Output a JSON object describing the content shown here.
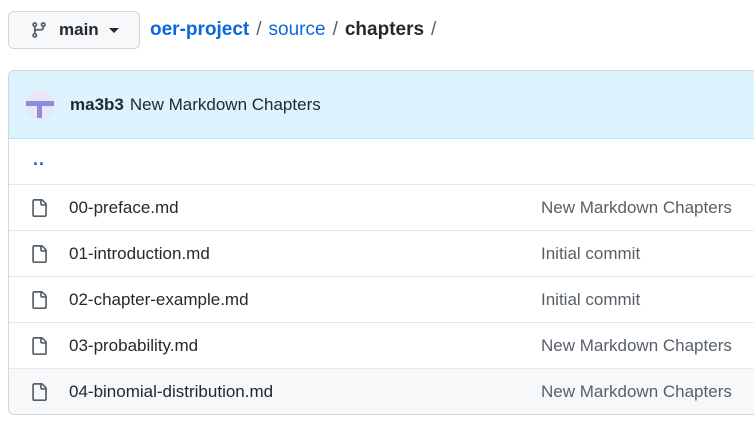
{
  "branch": {
    "name": "main",
    "icon": "git-branch-icon"
  },
  "breadcrumb": {
    "repo": "oer-project",
    "path": [
      "source"
    ],
    "current": "chapters",
    "separator": "/"
  },
  "latest_commit": {
    "author": "ma3b3",
    "message": "New Markdown Chapters",
    "avatar_icon": "identicon-avatar"
  },
  "parent_dir": "..",
  "files": [
    {
      "name": "00-preface.md",
      "commit_message": "New Markdown Chapters",
      "icon": "file-icon"
    },
    {
      "name": "01-introduction.md",
      "commit_message": "Initial commit",
      "icon": "file-icon"
    },
    {
      "name": "02-chapter-example.md",
      "commit_message": "Initial commit",
      "icon": "file-icon"
    },
    {
      "name": "03-probability.md",
      "commit_message": "New Markdown Chapters",
      "icon": "file-icon"
    },
    {
      "name": "04-binomial-distribution.md",
      "commit_message": "New Markdown Chapters",
      "icon": "file-icon"
    }
  ],
  "colors": {
    "link": "#0969da",
    "commit_header_bg": "#ddf4ff",
    "border": "#d0d7de",
    "muted_text": "#57606a"
  }
}
